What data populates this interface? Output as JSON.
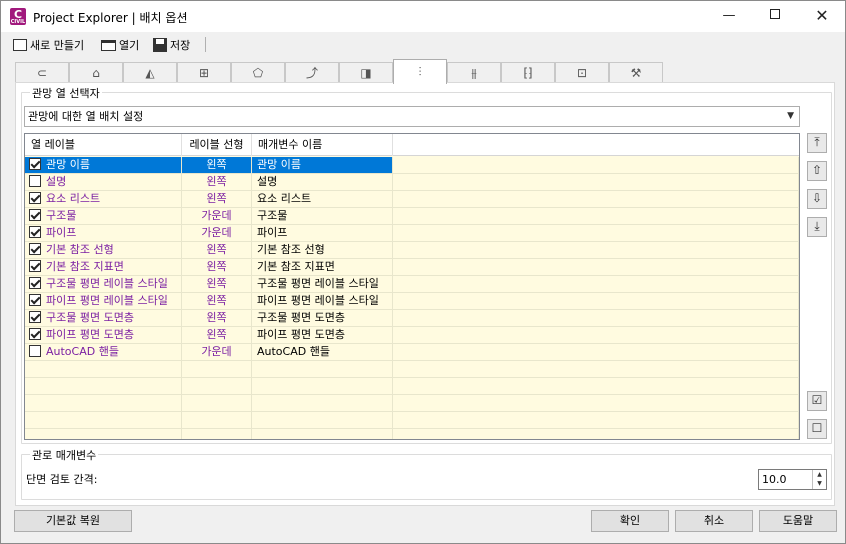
{
  "window": {
    "app_icon_letter": "C",
    "app_icon_sub": "CIVIL",
    "title": "Project Explorer | 배치 옵션",
    "minimize_glyph": "—",
    "close_glyph": "✕"
  },
  "toolbar": {
    "new_label": "새로 만들기",
    "open_label": "열기",
    "save_label": "저장"
  },
  "tabs": [
    {
      "icon": "alignment-icon",
      "glyph": "⊂"
    },
    {
      "icon": "profile-icon",
      "glyph": "⌂"
    },
    {
      "icon": "corridor-icon",
      "glyph": "◭"
    },
    {
      "icon": "assembly-icon",
      "glyph": "⊞"
    },
    {
      "icon": "surface-icon",
      "glyph": "⬠"
    },
    {
      "icon": "feature-line-icon",
      "glyph": "⤴"
    },
    {
      "icon": "parcel-icon",
      "glyph": "◨"
    },
    {
      "icon": "pipe-network-icon",
      "glyph": "⫶"
    },
    {
      "icon": "pressure-network-icon",
      "glyph": "⫵"
    },
    {
      "icon": "section-icon",
      "glyph": "⁅⁆"
    },
    {
      "icon": "label-icon",
      "glyph": "⊡"
    },
    {
      "icon": "settings-wrench-icon",
      "glyph": "⚒"
    }
  ],
  "active_tab_index": 7,
  "view_group": {
    "title": "관망 열 선택자",
    "dropdown_value": "관망에 대한 열 배치 설정",
    "dropdown_arrow": "▼"
  },
  "grid": {
    "headers": [
      "열 레이블",
      "레이블 선형",
      "매개변수 이름"
    ],
    "rows": [
      {
        "checked": true,
        "label": "관망 이름",
        "align": "왼쪽",
        "param": "관망 이름",
        "selected": true
      },
      {
        "checked": false,
        "label": "설명",
        "align": "왼쪽",
        "param": "설명",
        "selected": false
      },
      {
        "checked": true,
        "label": "요소 리스트",
        "align": "왼쪽",
        "param": "요소 리스트",
        "selected": false
      },
      {
        "checked": true,
        "label": "구조물",
        "align": "가운데",
        "param": "구조물",
        "selected": false
      },
      {
        "checked": true,
        "label": "파이프",
        "align": "가운데",
        "param": "파이프",
        "selected": false
      },
      {
        "checked": true,
        "label": "기본 참조 선형",
        "align": "왼쪽",
        "param": "기본 참조 선형",
        "selected": false
      },
      {
        "checked": true,
        "label": "기본 참조 지표면",
        "align": "왼쪽",
        "param": "기본 참조 지표면",
        "selected": false
      },
      {
        "checked": true,
        "label": "구조물 평면 레이블 스타일",
        "align": "왼쪽",
        "param": "구조물 평면 레이블 스타일",
        "selected": false
      },
      {
        "checked": true,
        "label": "파이프 평면 레이블 스타일",
        "align": "왼쪽",
        "param": "파이프 평면 레이블 스타일",
        "selected": false
      },
      {
        "checked": true,
        "label": "구조물 평면 도면층",
        "align": "왼쪽",
        "param": "구조물 평면 도면층",
        "selected": false
      },
      {
        "checked": true,
        "label": "파이프 평면 도면층",
        "align": "왼쪽",
        "param": "파이프 평면 도면층",
        "selected": false
      },
      {
        "checked": false,
        "label": "AutoCAD 핸들",
        "align": "가운데",
        "param": "AutoCAD 핸들",
        "selected": false
      }
    ],
    "empty_rows": 5
  },
  "side_buttons": {
    "move_top": "⤒",
    "move_up": "⇧",
    "move_down": "⇩",
    "move_bottom": "⤓",
    "check_all": "☑",
    "uncheck_all": "☐"
  },
  "params_group": {
    "title": "관로 매개변수",
    "spacing_label": "단면 검토 간격:",
    "spacing_value": "10.0"
  },
  "footer": {
    "reset_label": "기본값 복원",
    "ok_label": "확인",
    "cancel_label": "취소",
    "help_label": "도움말"
  },
  "colors": {
    "label_text": "#7b1fa2",
    "selection": "#0078d7",
    "grid_background": "#fffbe0",
    "app_icon": "#a1197d"
  }
}
